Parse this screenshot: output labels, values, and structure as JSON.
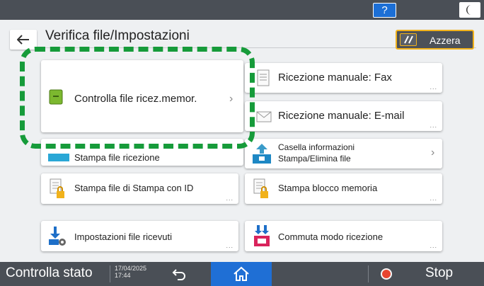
{
  "header": {
    "help_label": "?"
  },
  "title": {
    "text": "Verifica file/Impostazioni"
  },
  "reset": {
    "label": "Azzera"
  },
  "tiles": {
    "check_memory": {
      "label": "Controlla file ricez.memor."
    },
    "manual_fax": {
      "label": "Ricezione manuale: Fax"
    },
    "manual_email": {
      "label": "Ricezione manuale: E-mail"
    },
    "print_received": {
      "label": "Stampa file ricezione"
    },
    "infobox_line1": {
      "label": "Casella informazioni"
    },
    "infobox_line2": {
      "label": "Stampa/Elimina file"
    },
    "print_id": {
      "label": "Stampa file di Stampa con ID"
    },
    "print_memory_lock": {
      "label": "Stampa blocco memoria"
    },
    "received_settings": {
      "label": "Impostazioni file ricevuti"
    },
    "switch_mode": {
      "label": "Commuta modo ricezione"
    }
  },
  "more_indicator": "...",
  "footer": {
    "status_label": "Controlla stato",
    "date": "17/04/2025",
    "time": "17:44",
    "stop_label": "Stop"
  },
  "colors": {
    "accent_blue": "#1f6fd5",
    "highlight_green": "#169b3a",
    "reset_border": "#f1b21b",
    "stop_red": "#e8442f"
  }
}
